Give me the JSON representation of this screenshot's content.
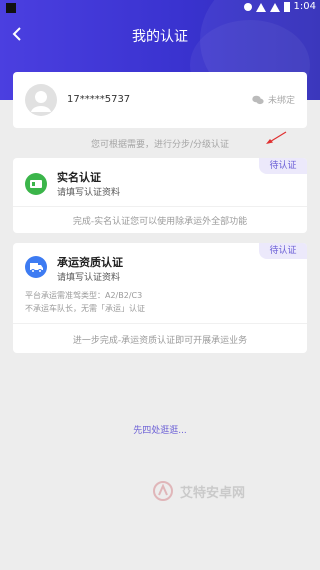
{
  "status_bar": {
    "time": "1:04"
  },
  "header": {
    "title": "我的认证"
  },
  "account": {
    "phone": "17*****5737",
    "wechat_status": "未绑定"
  },
  "hint_text": "您可根据需要，进行分步/分级认证",
  "cards": [
    {
      "badge": "待认证",
      "title": "实名认证",
      "subtitle": "请填写认证资料",
      "footer": "完成-实名认证您可以使用除承运外全部功能",
      "icon": "id-card-icon",
      "icon_color": "#3bb54a"
    },
    {
      "badge": "待认证",
      "title": "承运资质认证",
      "subtitle": "请填写认证资料",
      "notes": [
        "平台承运需准驾类型：A2/B2/C3",
        "不承运车队长，无需「承运」认证"
      ],
      "footer": "进一步完成-承运资质认证即可开展承运业务",
      "icon": "truck-icon",
      "icon_color": "#3d7bf2"
    }
  ],
  "stroll_text": "先四处逛逛...",
  "watermark": {
    "text": "艾特安卓网"
  },
  "colors": {
    "header": "#3d35d6",
    "accent": "#6b5fd6",
    "badge_bg": "#ece9fb",
    "bg": "#ededed"
  }
}
